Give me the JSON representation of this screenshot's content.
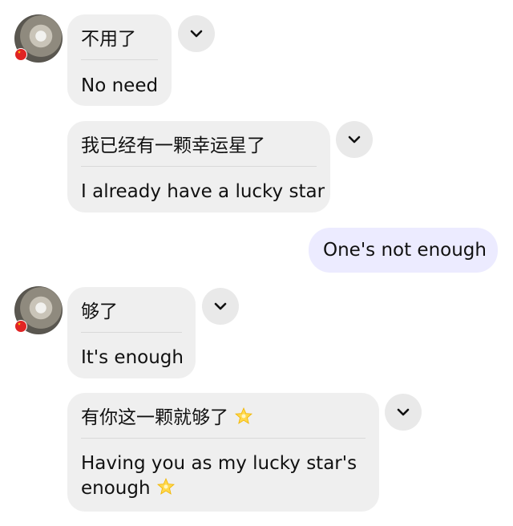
{
  "messages": [
    {
      "original": "不用了",
      "translation": "No need"
    },
    {
      "original": "我已经有一颗幸运星了",
      "translation": "I already have a lucky star"
    },
    {
      "sent": "One's not enough"
    },
    {
      "original": "够了",
      "translation": "It's enough"
    },
    {
      "original": "有你这一颗就够了",
      "translation": "Having you as my lucky star's",
      "translation_line2": "enough",
      "emoji": "glowing-star"
    }
  ],
  "icons": {
    "translate_toggle": "chevron-down-icon",
    "avatar_badge": "china-flag-icon"
  },
  "colors": {
    "received_bubble": "#efefef",
    "sent_bubble": "#ecebff",
    "toggle_bg": "#e9e9e9"
  }
}
